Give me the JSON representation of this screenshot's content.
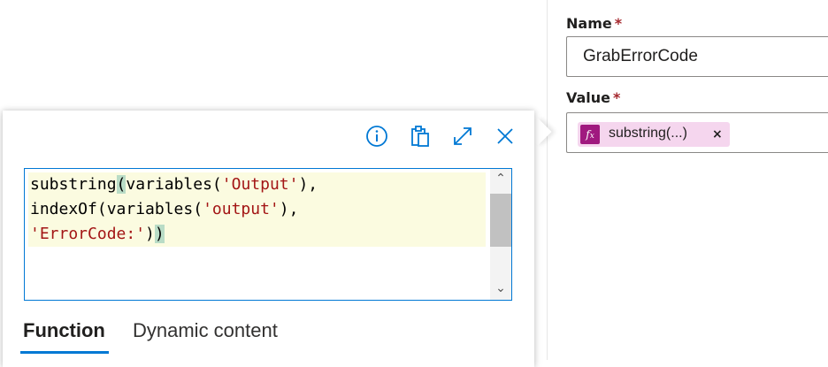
{
  "properties": {
    "name_label": "Name",
    "required_marker": "*",
    "name_value": "GrabErrorCode",
    "value_label": "Value",
    "token": {
      "icon": "fx-icon",
      "text": "substring(...)",
      "remove": "×"
    }
  },
  "flyout": {
    "toolbar": [
      {
        "name": "info-icon"
      },
      {
        "name": "clipboard-icon"
      },
      {
        "name": "expand-icon"
      },
      {
        "name": "close-icon"
      }
    ],
    "code": {
      "line1": {
        "a": "substring",
        "b": "(",
        "c": "variables(",
        "d": "'Output'",
        "e": "),"
      },
      "line2": {
        "a": "indexOf(variables(",
        "b": "'output'",
        "c": "),"
      },
      "line3": {
        "a": "'ErrorCode:'",
        "b": ")",
        "c": ")"
      }
    },
    "tabs": [
      {
        "label": "Function",
        "active": true
      },
      {
        "label": "Dynamic content",
        "active": false
      }
    ]
  },
  "colors": {
    "accent": "#0078d4",
    "token_bg": "#f5d6ee",
    "fx_badge": "#a0197f",
    "string": "#a31515",
    "required": "#a4262c"
  }
}
